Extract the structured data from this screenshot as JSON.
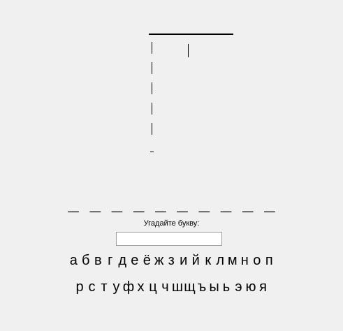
{
  "word": {
    "mask": "_ _ _ _ _ _ _ _ _ _"
  },
  "prompt": {
    "label": "Угадайте букву:",
    "input_value": ""
  },
  "alphabet": {
    "row1": [
      "а",
      "б",
      "в",
      "г",
      "д",
      "е",
      "ё",
      "ж",
      "з",
      "и",
      "й",
      "к",
      "л",
      "м",
      "н",
      "о",
      "п"
    ],
    "row2": [
      "р",
      "с",
      "т",
      "у",
      "ф",
      "х",
      "ц",
      "ч",
      "ш",
      "щ",
      "ъ",
      "ы",
      "ь",
      "э",
      "ю",
      "я"
    ]
  },
  "gallows": {
    "stage": 0
  }
}
